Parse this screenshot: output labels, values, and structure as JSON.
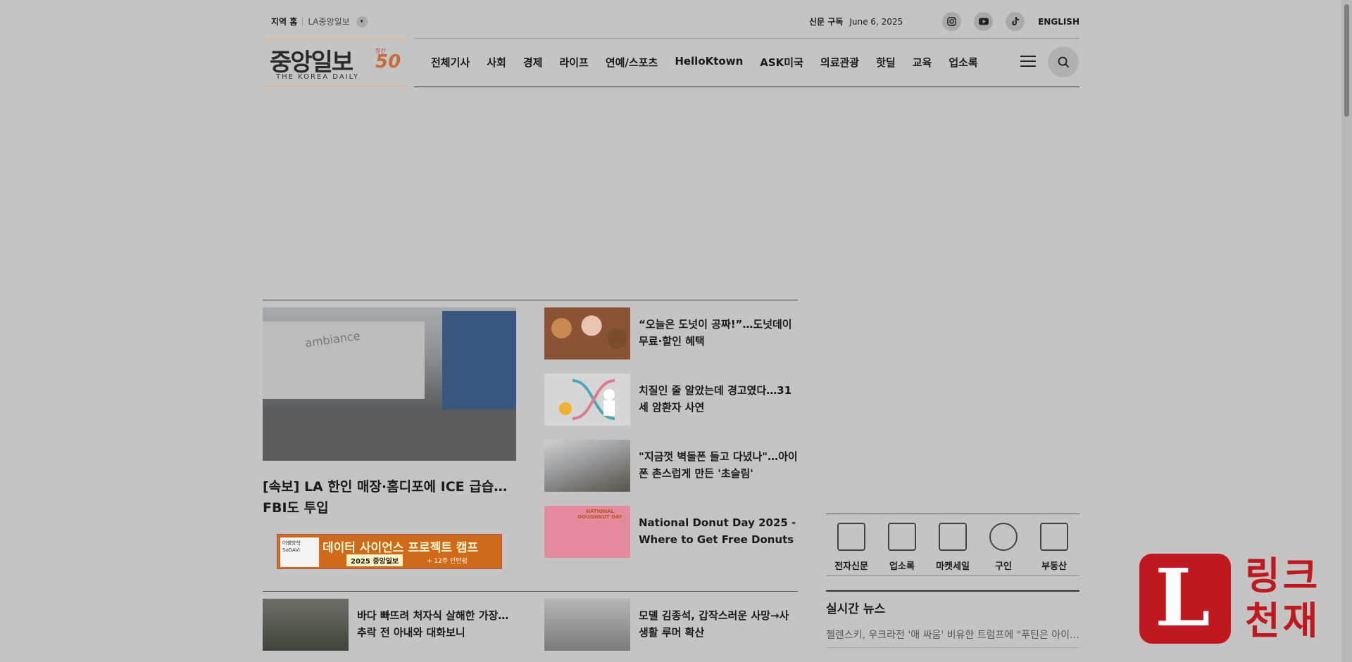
{
  "topbar": {
    "region_home": "지역 홈",
    "region_local": "LA중앙일보",
    "subscribe": "신문 구독",
    "date": "June 6, 2025",
    "sns": [
      "instagram-icon",
      "youtube-icon",
      "tiktok-icon"
    ],
    "english": "ENGLISH"
  },
  "logo": {
    "korean": "중앙일보",
    "english": "THE KOREA DAILY",
    "anniversary_label": "창간",
    "anniversary_number": "50"
  },
  "nav": {
    "items": [
      "전체기사",
      "사회",
      "경제",
      "라이프",
      "연예/스포츠",
      "HelloKtown",
      "ASK미국",
      "의료관광",
      "핫딜",
      "교육",
      "업소록"
    ]
  },
  "lead": {
    "image_sign": "ambiance",
    "title": "[속보] LA 한인 매장·홈디포에 ICE 급습…FBI도 투입"
  },
  "banner": {
    "small": "어썸방학",
    "headline": "데이터 사이언스 프로젝트 캠프",
    "sub": "2025 중앙일보",
    "note": "+ 12주 인턴쉽",
    "sponsor": "SoDAVi"
  },
  "side_news": [
    {
      "title": "“오늘은 도넛이 공짜!”…도넛데이 무료·할인 혜택"
    },
    {
      "title": "치질인 줄 알았는데 경고였다…31세 암환자 사연"
    },
    {
      "title": "\"지금껏 벽돌폰 들고 다녔나\"…아이폰 촌스럽게 만든 '초슬림'"
    },
    {
      "title": "National Donut Day 2025 - Where to Get Free Donuts",
      "thumb_label": "NATIONAL DOUGHNUT DAY"
    }
  ],
  "row2": [
    {
      "title": "바다 빠뜨려 처자식 살해한 가장…추락 전 아내와 대화보니"
    },
    {
      "title": "모델 김종석, 갑작스러운 사망→사생활 루머 확산"
    }
  ],
  "quick_links": [
    {
      "label": "전자신문",
      "icon": "newspaper-icon"
    },
    {
      "label": "업소록",
      "icon": "clipboard-icon"
    },
    {
      "label": "마켓세일",
      "icon": "cart-icon"
    },
    {
      "label": "구인",
      "icon": "people-search-icon"
    },
    {
      "label": "부동산",
      "icon": "house-icon"
    }
  ],
  "live_news": {
    "heading": "실시간 뉴스",
    "items": [
      "젤렌스키, 우크라전 '애 싸움' 비유한 트럼프에 \"푸틴은 아이가 아니다\""
    ]
  },
  "watermark": {
    "letter": "L",
    "text_line1": "링크",
    "text_line2": "천재"
  }
}
